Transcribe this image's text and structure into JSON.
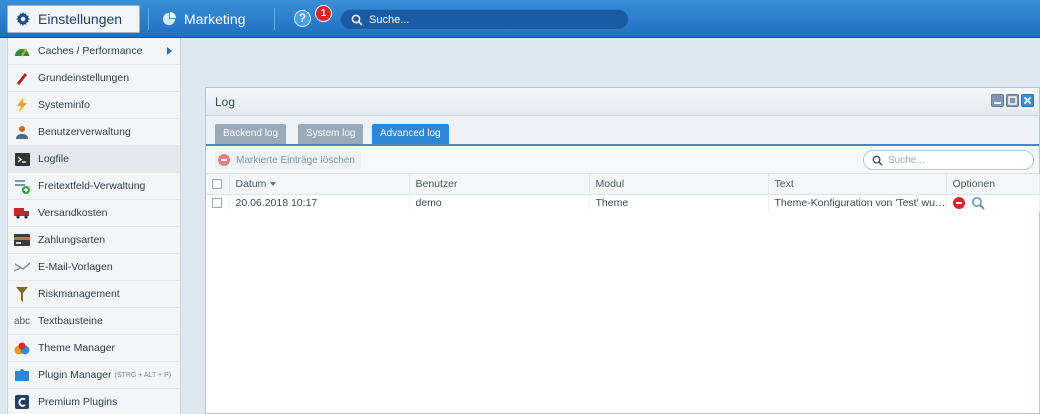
{
  "topbar": {
    "settings_label": "Einstellungen",
    "marketing_label": "Marketing",
    "help_icon": "?",
    "notification_count": "1",
    "search_placeholder": "Suche..."
  },
  "sidebar": {
    "items": [
      {
        "label": "Caches / Performance",
        "icon": "speedometer-icon",
        "color": "#2f8a3a",
        "has_submenu": true
      },
      {
        "label": "Grundeinstellungen",
        "icon": "pencil-icon",
        "color": "#b1202a"
      },
      {
        "label": "Systeminfo",
        "icon": "lightning-icon",
        "color": "#f0a318"
      },
      {
        "label": "Benutzerverwaltung",
        "icon": "user-icon",
        "color": "#c66a2a"
      },
      {
        "label": "Logfile",
        "icon": "terminal-icon",
        "color": "#333333"
      },
      {
        "label": "Freitextfeld-Verwaltung",
        "icon": "list-add-icon",
        "color": "#3aa14a"
      },
      {
        "label": "Versandkosten",
        "icon": "truck-icon",
        "color": "#c02a2a"
      },
      {
        "label": "Zahlungsarten",
        "icon": "credit-card-icon",
        "color": "#c7781e"
      },
      {
        "label": "E-Mail-Vorlagen",
        "icon": "envelope-icon",
        "color": "#7c8fa3"
      },
      {
        "label": "Riskmanagement",
        "icon": "funnel-icon",
        "color": "#7d6a2b"
      },
      {
        "label": "Textbausteine",
        "icon": "abc-icon",
        "color": "#555555"
      },
      {
        "label": "Theme Manager",
        "icon": "paint-icon",
        "color": "#e09b25"
      },
      {
        "label": "Plugin Manager",
        "shortcut": "(STRG + ALT + P)",
        "icon": "puzzle-icon",
        "color": "#2f86d4"
      },
      {
        "label": "Premium Plugins",
        "icon": "shopware-icon",
        "color": "#1f3f63"
      }
    ]
  },
  "window": {
    "title": "Log",
    "tabs": [
      "Backend log",
      "System log",
      "Advanced log"
    ],
    "active_tab": 2,
    "delete_button": "Markierte Einträge löschen",
    "search_placeholder": "Suche...",
    "columns": [
      "Datum",
      "Benutzer",
      "Modul",
      "Text",
      "Optionen"
    ],
    "rows": [
      {
        "datum": "20.06.2018 10:17",
        "benutzer": "demo",
        "modul": "Theme",
        "text": "Theme-Konfiguration von 'Test' wur..."
      }
    ]
  },
  "colors": {
    "accent": "#2f86d4",
    "topbar": "#1f6fc0",
    "danger": "#d8262c"
  }
}
